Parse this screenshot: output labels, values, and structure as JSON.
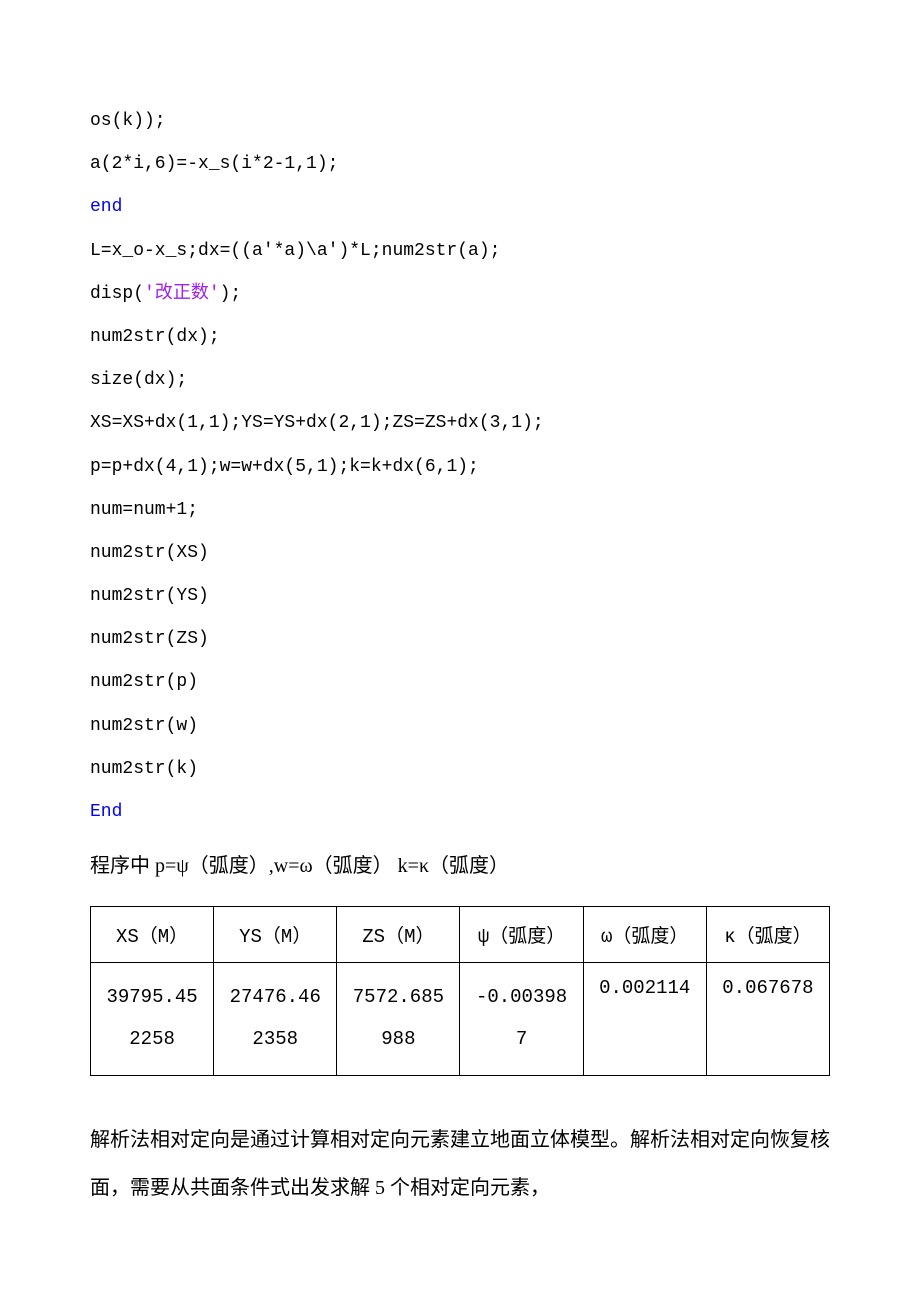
{
  "code": {
    "l1": "os(k));",
    "l2": "a(2*i,6)=-x_s(i*2-1,1);",
    "l3": "end",
    "l4": "L=x_o-x_s;dx=((a'*a)\\a')*L;num2str(a);",
    "l5a": "disp(",
    "l5b": "'改正数'",
    "l5c": ");",
    "l6": "num2str(dx);",
    "l7": "size(dx);",
    "l8": "XS=XS+dx(1,1);YS=YS+dx(2,1);ZS=ZS+dx(3,1);",
    "l9": "p=p+dx(4,1);w=w+dx(5,1);k=k+dx(6,1);",
    "l10": "num=num+1;",
    "l11": "num2str(XS)",
    "l12": "num2str(YS)",
    "l13": "num2str(ZS)",
    "l14": "num2str(p)",
    "l15": "num2str(w)",
    "l16": "num2str(k)",
    "l17": "End"
  },
  "caption": "程序中 p=ψ（弧度）,w=ω（弧度） k=κ（弧度）",
  "table": {
    "headers": [
      "XS（M）",
      "YS（M）",
      "ZS（M）",
      "ψ（弧度）",
      "ω（弧度）",
      "κ（弧度）"
    ],
    "row": [
      "39795.45\n2258",
      "27476.46\n2358",
      "7572.685\n988",
      "-0.00398\n7",
      "0.002114",
      "0.067678"
    ]
  },
  "chart_data": {
    "type": "table",
    "title": "",
    "columns": [
      "XS（M）",
      "YS（M）",
      "ZS（M）",
      "ψ（弧度）",
      "ω（弧度）",
      "κ（弧度）"
    ],
    "rows": [
      [
        "39795.452258",
        "27476.462358",
        "7572.685988",
        "-0.003987",
        "0.002114",
        "0.067678"
      ]
    ]
  },
  "paragraph": "解析法相对定向是通过计算相对定向元素建立地面立体模型。解析法相对定向恢复核面，需要从共面条件式出发求解 5 个相对定向元素，"
}
